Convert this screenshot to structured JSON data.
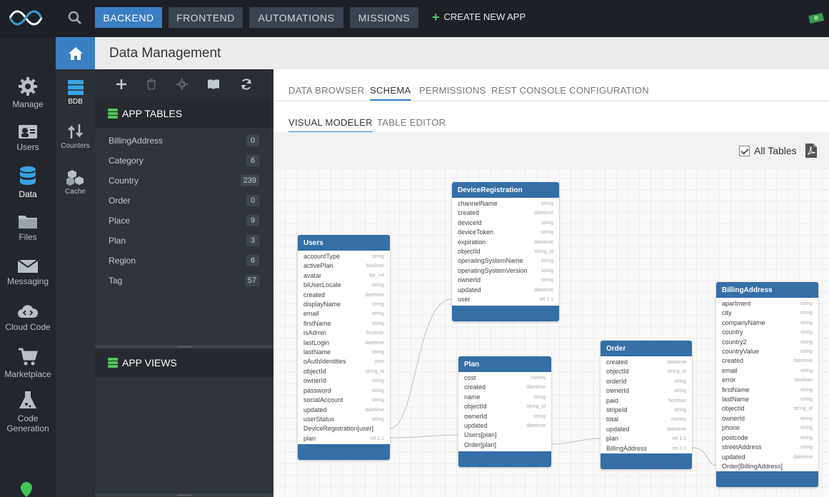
{
  "topbar": {
    "nav": [
      "BACKEND",
      "FRONTEND",
      "AUTOMATIONS",
      "MISSIONS"
    ],
    "create_app": "CREATE NEW APP"
  },
  "leftnav": [
    {
      "label": "Manage",
      "icon": "gear-icon"
    },
    {
      "label": "Users",
      "icon": "users-icon"
    },
    {
      "label": "Data",
      "icon": "database-icon"
    },
    {
      "label": "Files",
      "icon": "folder-icon"
    },
    {
      "label": "Messaging",
      "icon": "envelope-icon"
    },
    {
      "label": "Cloud Code",
      "icon": "cloud-code-icon"
    },
    {
      "label": "Marketplace",
      "icon": "cart-icon"
    },
    {
      "label": "Code Generation",
      "icon": "flask-icon"
    }
  ],
  "subnav": [
    {
      "label": "BDB",
      "icon": "bdb-icon"
    },
    {
      "label": "Counters",
      "icon": "counters-icon"
    },
    {
      "label": "Cache",
      "icon": "cache-icon"
    }
  ],
  "header": {
    "title": "Data Management"
  },
  "panel": {
    "app_tables": "APP TABLES",
    "app_views": "APP VIEWS",
    "tables": [
      {
        "name": "BillingAddress",
        "count": "0"
      },
      {
        "name": "Category",
        "count": "6"
      },
      {
        "name": "Country",
        "count": "239"
      },
      {
        "name": "Order",
        "count": "0"
      },
      {
        "name": "Place",
        "count": "9"
      },
      {
        "name": "Plan",
        "count": "3"
      },
      {
        "name": "Region",
        "count": "6"
      },
      {
        "name": "Tag",
        "count": "57"
      }
    ]
  },
  "tabs": [
    "DATA BROWSER",
    "SCHEMA",
    "PERMISSIONS",
    "REST CONSOLE",
    "CONFIGURATION"
  ],
  "subtabs": [
    "VISUAL MODELER",
    "TABLE EDITOR"
  ],
  "canvas": {
    "all_tables": "All Tables"
  },
  "schema": {
    "device": {
      "title": "DeviceRegistration",
      "fields": [
        [
          "channelName",
          "string"
        ],
        [
          "created",
          "datetime"
        ],
        [
          "deviceId",
          "string"
        ],
        [
          "deviceToken",
          "string"
        ],
        [
          "expiration",
          "datetime"
        ],
        [
          "objectId",
          "string_id"
        ],
        [
          "operatingSystemName",
          "string"
        ],
        [
          "operatingSystemVersion",
          "string"
        ],
        [
          "ownerId",
          "string"
        ],
        [
          "updated",
          "datetime"
        ],
        [
          "user",
          "rel 1:1"
        ]
      ]
    },
    "users": {
      "title": "Users",
      "fields": [
        [
          "accountType",
          "string"
        ],
        [
          "activePlan",
          "boolean"
        ],
        [
          "avatar",
          "file_ref"
        ],
        [
          "blUserLocale",
          "string"
        ],
        [
          "created",
          "datetime"
        ],
        [
          "displayName",
          "string"
        ],
        [
          "email",
          "string"
        ],
        [
          "firstName",
          "string"
        ],
        [
          "isAdmin",
          "boolean"
        ],
        [
          "lastLogin",
          "datetime"
        ],
        [
          "lastName",
          "string"
        ],
        [
          "oAuthIdentities",
          "json"
        ],
        [
          "objectId",
          "string_id"
        ],
        [
          "ownerId",
          "string"
        ],
        [
          "password",
          "string"
        ],
        [
          "socialAccount",
          "string"
        ],
        [
          "updated",
          "datetime"
        ],
        [
          "userStatus",
          "string"
        ],
        [
          "DeviceRegistration[user]",
          ""
        ],
        [
          "plan",
          "rel 1:1"
        ]
      ]
    },
    "plan": {
      "title": "Plan",
      "fields": [
        [
          "cost",
          "money"
        ],
        [
          "created",
          "datetime"
        ],
        [
          "name",
          "string"
        ],
        [
          "objectId",
          "string_id"
        ],
        [
          "ownerId",
          "string"
        ],
        [
          "updated",
          "datetime"
        ],
        [
          "Users[plan]",
          ""
        ],
        [
          "Order[plan]",
          ""
        ]
      ]
    },
    "order": {
      "title": "Order",
      "fields": [
        [
          "created",
          "datetime"
        ],
        [
          "objectId",
          "string_id"
        ],
        [
          "orderId",
          "string"
        ],
        [
          "ownerId",
          "string"
        ],
        [
          "paid",
          "boolean"
        ],
        [
          "stripeId",
          "string"
        ],
        [
          "total",
          "money"
        ],
        [
          "updated",
          "datetime"
        ],
        [
          "plan",
          "rel 1:1"
        ],
        [
          "BillingAddress",
          "rel 1:1"
        ]
      ]
    },
    "billing": {
      "title": "BillingAddress",
      "fields": [
        [
          "apartment",
          "string"
        ],
        [
          "city",
          "string"
        ],
        [
          "companyName",
          "string"
        ],
        [
          "country",
          "string"
        ],
        [
          "country2",
          "string"
        ],
        [
          "countryValue",
          "string"
        ],
        [
          "created",
          "datetime"
        ],
        [
          "email",
          "string"
        ],
        [
          "error",
          "boolean"
        ],
        [
          "firstName",
          "string"
        ],
        [
          "lastName",
          "string"
        ],
        [
          "objectId",
          "string_id"
        ],
        [
          "ownerId",
          "string"
        ],
        [
          "phone",
          "string"
        ],
        [
          "postcode",
          "string"
        ],
        [
          "streetAddress",
          "string"
        ],
        [
          "updated",
          "datetime"
        ],
        [
          "Order[BillingAddress]",
          ""
        ]
      ]
    }
  }
}
